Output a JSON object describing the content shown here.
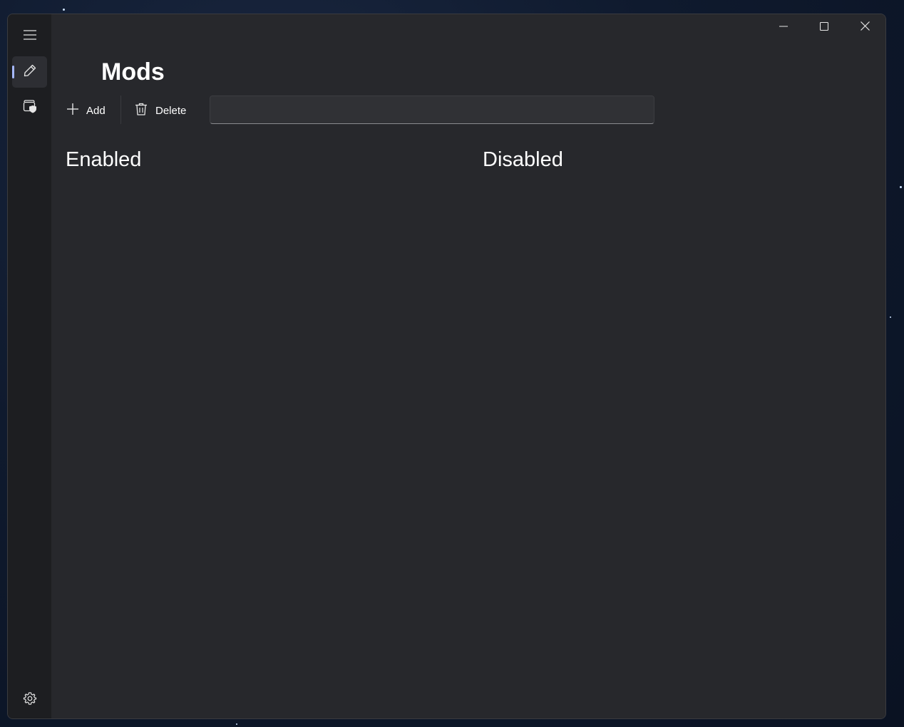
{
  "navigation": {
    "menu_icon": "hamburger-icon",
    "items": [
      {
        "icon": "pencil-icon",
        "selected": true
      },
      {
        "icon": "wallet-shield-icon",
        "selected": false
      }
    ],
    "settings_icon": "gear-icon"
  },
  "window_controls": {
    "minimize_icon": "minimize-icon",
    "maximize_icon": "maximize-icon",
    "close_icon": "close-icon"
  },
  "page": {
    "title": "Mods"
  },
  "toolbar": {
    "add_label": "Add",
    "delete_label": "Delete"
  },
  "search": {
    "value": "",
    "placeholder": ""
  },
  "sections": {
    "enabled_title": "Enabled",
    "disabled_title": "Disabled"
  },
  "colors": {
    "window_bg": "#232428",
    "content_bg": "#27282c",
    "nav_bg": "#1d1e21",
    "accent": "#a6b8ff",
    "text": "#ffffff"
  }
}
